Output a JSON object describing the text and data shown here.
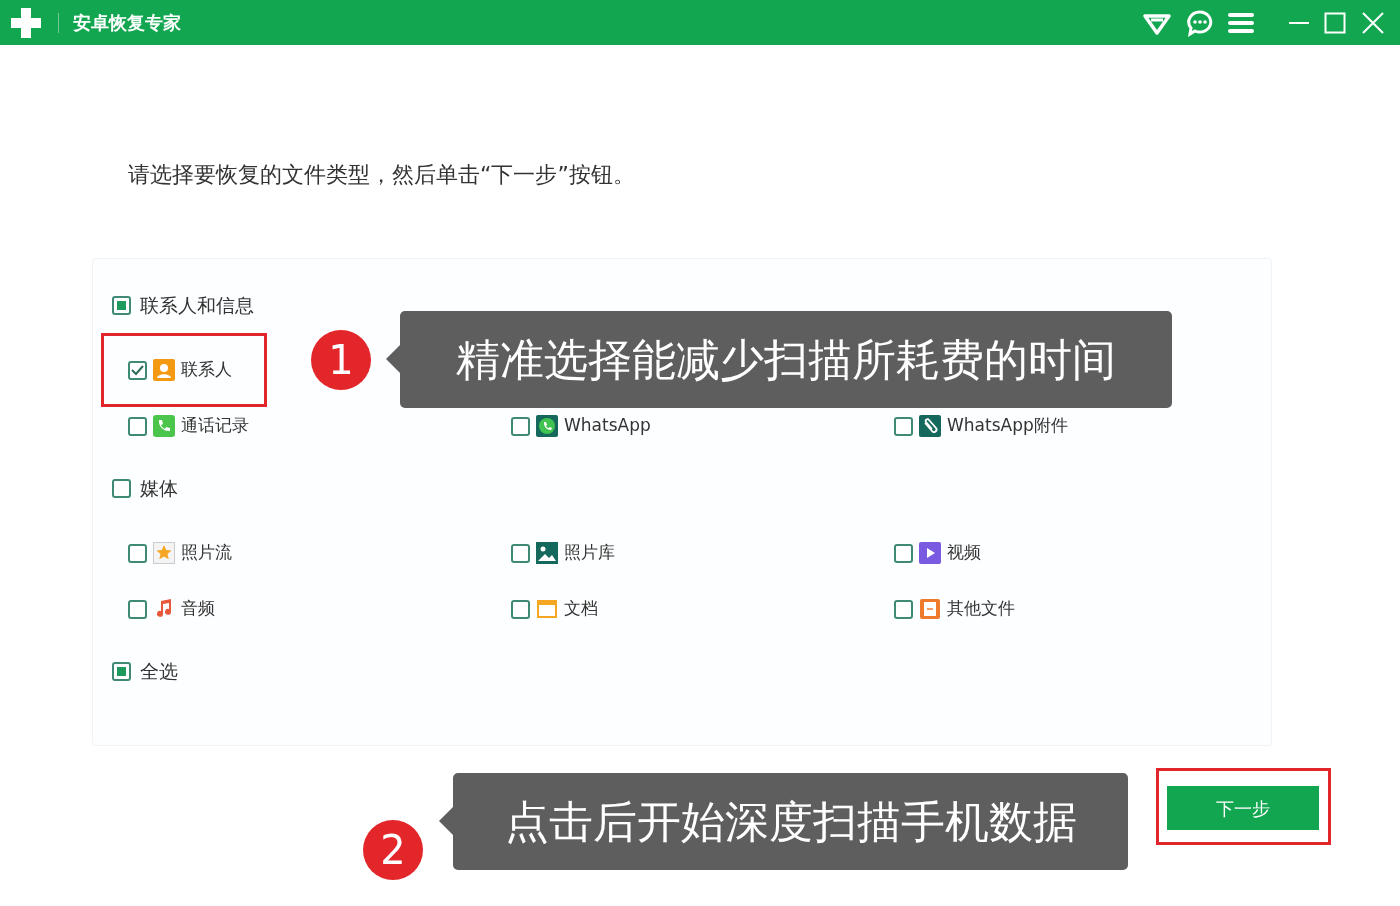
{
  "window": {
    "title": "安卓恢复专家"
  },
  "instruction": "请选择要恢复的文件类型，然后单击“下一步”按钮。",
  "groups": [
    {
      "label": "联系人和信息",
      "partial": true,
      "rows": [
        [
          {
            "label": "联系人",
            "kind": "contact",
            "checked": true,
            "highlighted": true
          }
        ],
        [
          {
            "label": "通话记录",
            "kind": "calls",
            "checked": false,
            "highlighted": false
          },
          {
            "label": "WhatsApp",
            "kind": "whatsapp",
            "checked": false,
            "highlighted": false
          },
          {
            "label": "WhatsApp附件",
            "kind": "attachment",
            "checked": false,
            "highlighted": false
          }
        ]
      ]
    },
    {
      "label": "媒体",
      "partial": false,
      "rows": [
        [
          {
            "label": "照片流",
            "kind": "photostream",
            "checked": false,
            "highlighted": false
          },
          {
            "label": "照片库",
            "kind": "gallery",
            "checked": false,
            "highlighted": false
          },
          {
            "label": "视频",
            "kind": "video",
            "checked": false,
            "highlighted": false
          }
        ],
        [
          {
            "label": "音频",
            "kind": "audio",
            "checked": false,
            "highlighted": false
          },
          {
            "label": "文档",
            "kind": "document",
            "checked": false,
            "highlighted": false
          },
          {
            "label": "其他文件",
            "kind": "other",
            "checked": false,
            "highlighted": false
          }
        ]
      ]
    }
  ],
  "select_all": {
    "label": "全选",
    "partial": true
  },
  "next_button": {
    "label": "下一步",
    "highlighted": true
  },
  "callouts": [
    {
      "number": "1",
      "text": "精准选择能减少扫描所耗费的时间"
    },
    {
      "number": "2",
      "text": "点击后开始深度扫描手机数据"
    }
  ]
}
